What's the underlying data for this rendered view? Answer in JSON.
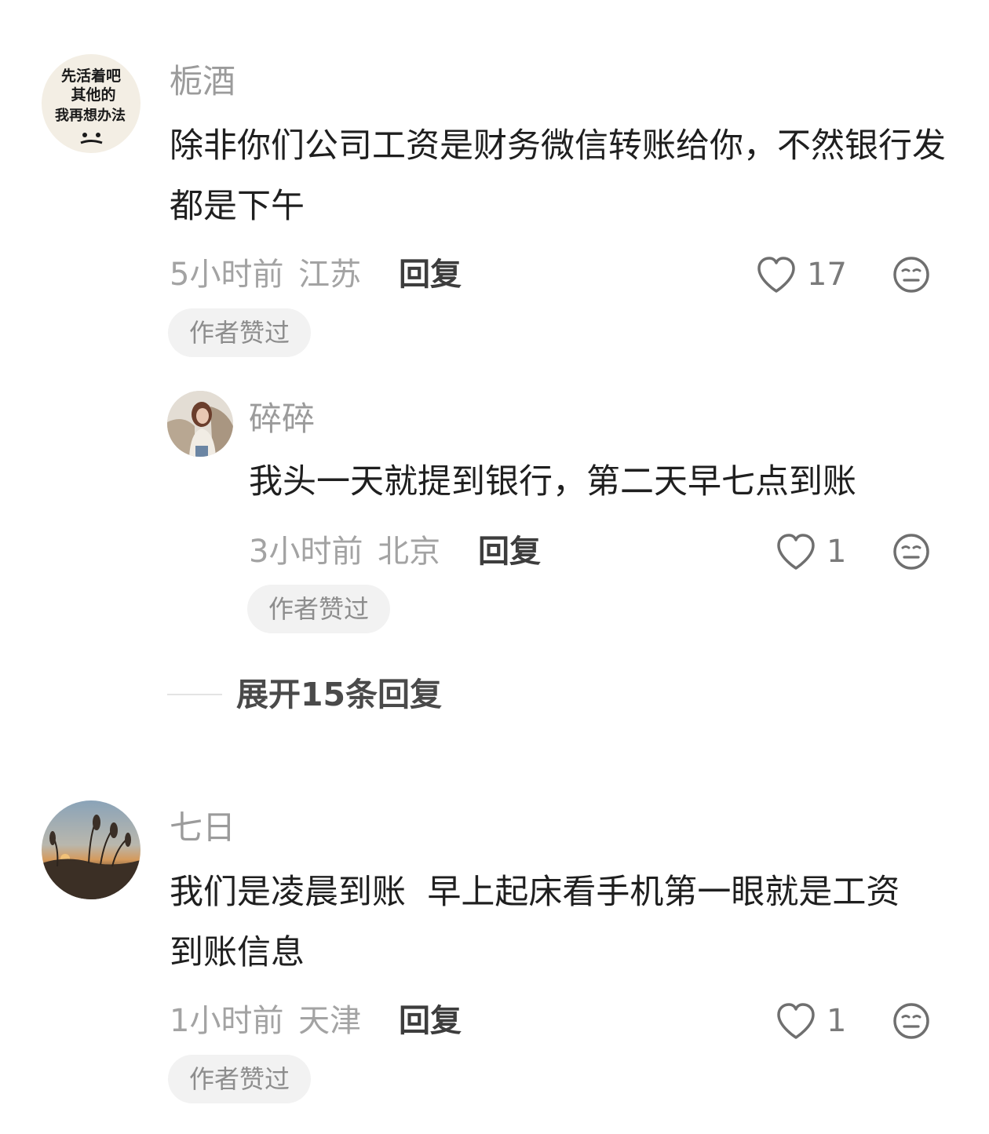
{
  "comments": [
    {
      "author": "栀酒",
      "avatar_text": [
        "先活着吧",
        "其他的",
        "我再想办法",
        "-_-"
      ],
      "text": "除非你们公司工资是财务微信转账给你，不然银行发都是下午",
      "time": "5小时前",
      "location": "江苏",
      "reply_label": "回复",
      "likes": "17",
      "badge": "作者赞过",
      "replies": [
        {
          "author": "碎碎",
          "text": "我头一天就提到银行，第二天早七点到账",
          "time": "3小时前",
          "location": "北京",
          "reply_label": "回复",
          "likes": "1",
          "badge": "作者赞过"
        }
      ],
      "expand_label": "展开15条回复"
    },
    {
      "author": "七日",
      "text": "我们是凌晨到账  早上起床看手机第一眼就是工资到账信息",
      "time": "1小时前",
      "location": "天津",
      "reply_label": "回复",
      "likes": "1",
      "badge": "作者赞过"
    }
  ]
}
